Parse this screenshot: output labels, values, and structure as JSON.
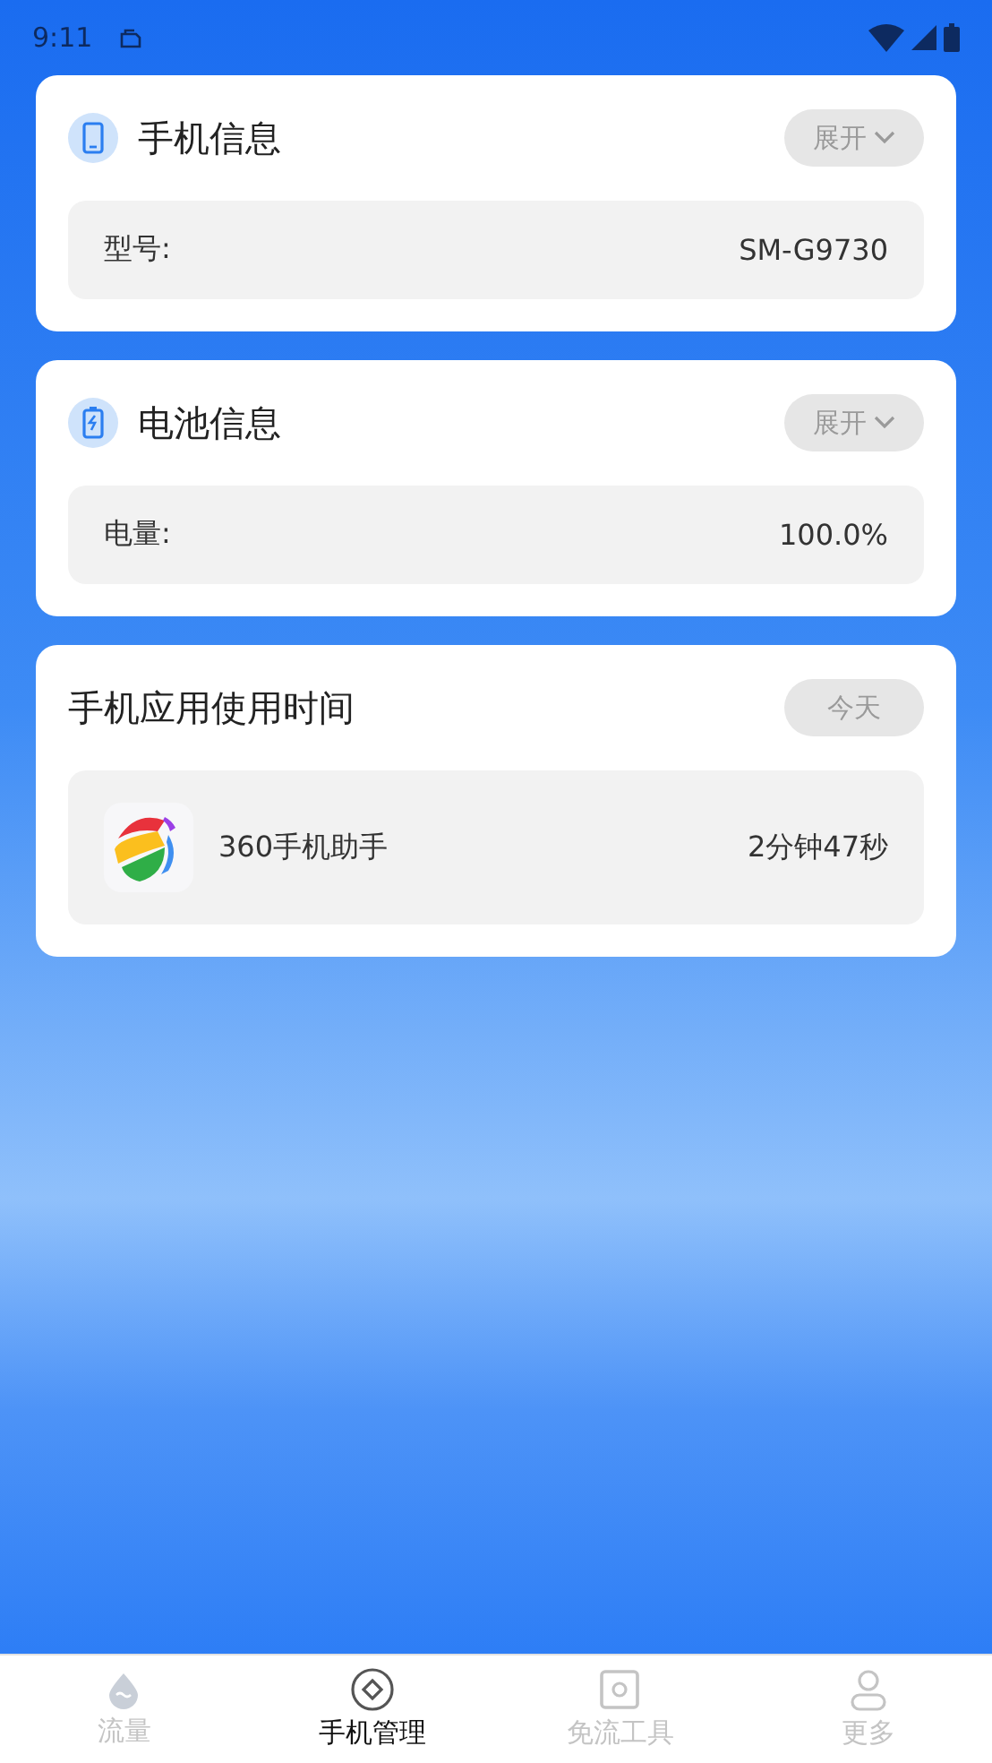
{
  "status_bar": {
    "time": "9:11"
  },
  "cards": [
    {
      "kind": "info",
      "title": "手机信息",
      "action": "展开",
      "rows": [
        {
          "label": "型号:",
          "value": "SM-G9730"
        }
      ]
    },
    {
      "kind": "info",
      "title": "电池信息",
      "action": "展开",
      "rows": [
        {
          "label": "电量:",
          "value": "100.0%"
        }
      ]
    },
    {
      "kind": "usage",
      "title": "手机应用使用时间",
      "action": "今天",
      "rows": [
        {
          "label": "360手机助手",
          "value": "2分钟47秒"
        }
      ]
    }
  ],
  "bottom_nav": [
    {
      "label": "流量",
      "selected": false
    },
    {
      "label": "手机管理",
      "selected": true
    },
    {
      "label": "免流工具",
      "selected": false
    },
    {
      "label": "更多",
      "selected": false
    }
  ]
}
